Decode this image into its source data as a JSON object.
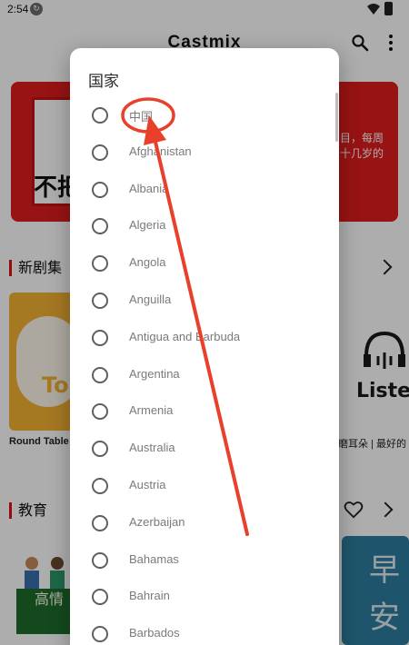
{
  "status_bar": {
    "time": "2:54"
  },
  "app": {
    "title": "Castmix"
  },
  "banner": {
    "cn_text": "不把",
    "desc_line1": "目，每周",
    "desc_line2": "十几岁的"
  },
  "sections": {
    "new_episodes": {
      "title": "新剧集"
    },
    "education": {
      "title": "教育"
    }
  },
  "cards": {
    "round_table": {
      "logo_text": "To",
      "caption": "Round Table"
    },
    "listen": {
      "logo_text": "Liste",
      "caption": "磨耳朵 | 最好的"
    },
    "edu_left": {
      "strip_text": "高情"
    },
    "edu_right": {
      "glyph1": "早",
      "glyph2": "安"
    }
  },
  "dialog": {
    "title": "国家",
    "options": [
      "中国",
      "Afghanistan",
      "Albania",
      "Algeria",
      "Angola",
      "Anguilla",
      "Antigua and Barbuda",
      "Argentina",
      "Armenia",
      "Australia",
      "Austria",
      "Azerbaijan",
      "Bahamas",
      "Bahrain",
      "Barbados"
    ]
  },
  "colors": {
    "accent_red": "#e11d1d",
    "annotation_red": "#e8402a"
  }
}
